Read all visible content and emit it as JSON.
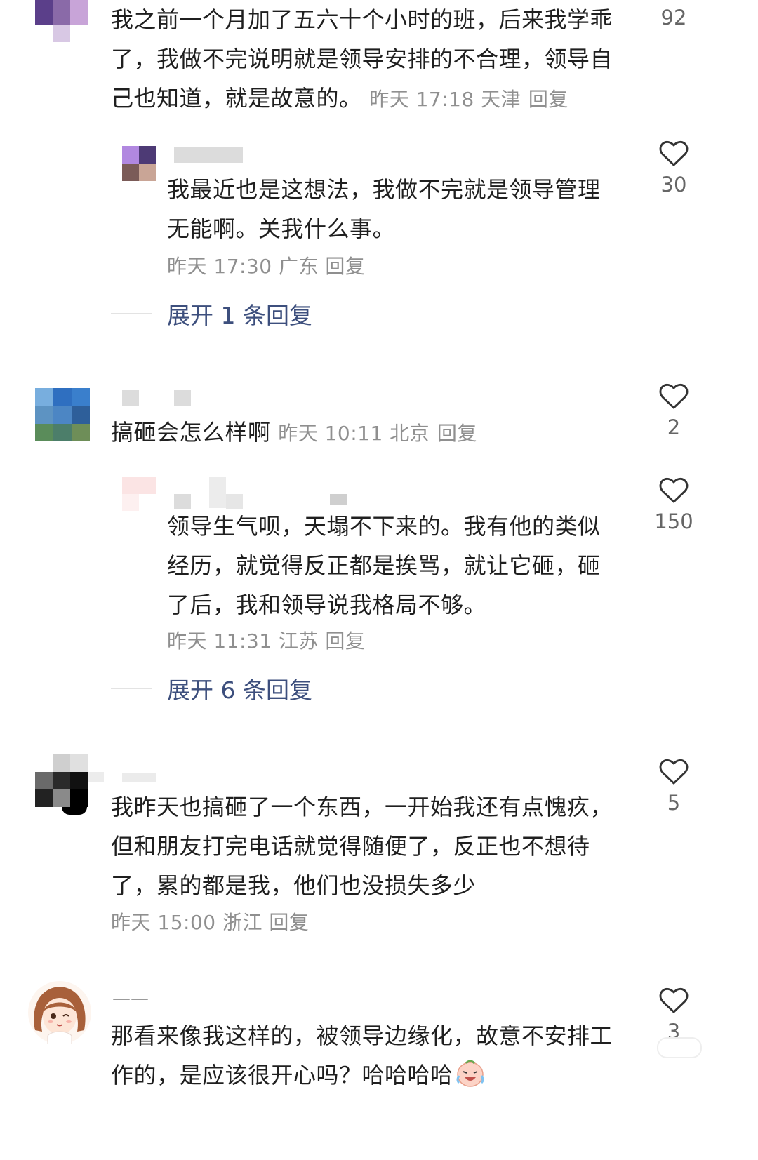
{
  "comments": [
    {
      "text": "我之前一个月加了五六十个小时的班，后来我学乖了，我做不完说明就是领导安排的不合理，领导自己也知道，就是故意的。",
      "meta": "昨天 17:18 天津",
      "reply": "回复",
      "likes": "92"
    },
    {
      "text": "我最近也是这想法，我做不完就是领导管理无能啊。关我什么事。",
      "meta": "昨天 17:30 广东",
      "reply": "回复",
      "likes": "30",
      "expand": "展开 1 条回复"
    },
    {
      "text": "搞砸会怎么样啊",
      "meta": "昨天 10:11 北京",
      "reply": "回复",
      "likes": "2"
    },
    {
      "text": "领导生气呗，天塌不下来的。我有他的类似经历，就觉得反正都是挨骂，就让它砸，砸了后，我和领导说我格局不够。",
      "meta": "昨天 11:31 江苏",
      "reply": "回复",
      "likes": "150",
      "expand": "展开 6 条回复"
    },
    {
      "text": "我昨天也搞砸了一个东西，一开始我还有点愧疚，但和朋友打完电话就觉得随便了，反正也不想待了，累的都是我，他们也没损失多少",
      "meta": "昨天 15:00 浙江",
      "reply": "回复",
      "likes": "5"
    },
    {
      "name": "——",
      "text": "那看来像我这样的，被领导边缘化，故意不安排工作的，是应该很开心吗？哈哈哈哈",
      "likes": "3"
    }
  ],
  "icons": {
    "like": "heart-outline-icon",
    "emoji": "crying-laughing-emoji-icon"
  },
  "colors": {
    "link": "#3d4f7d",
    "meta": "#8f8f8f"
  }
}
